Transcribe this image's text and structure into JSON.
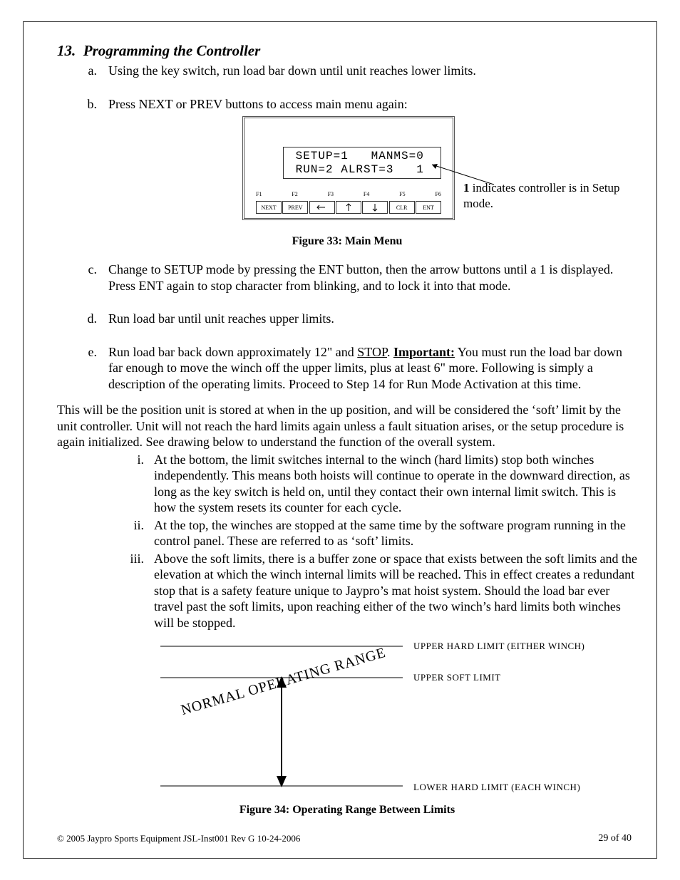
{
  "section": {
    "number": "13.",
    "title": "Programming the Controller"
  },
  "steps": {
    "a": {
      "marker": "a.",
      "text": "Using the key switch, run load bar down until unit reaches lower limits."
    },
    "b": {
      "marker": "b.",
      "text": "Press NEXT or PREV buttons to access main menu again:"
    },
    "c": {
      "marker": "c.",
      "text": "Change to SETUP mode by pressing the ENT button, then the arrow buttons until a 1 is displayed. Press ENT again to stop character from blinking, and to lock it into that mode."
    },
    "d": {
      "marker": "d.",
      "text": "Run load bar until unit reaches upper limits."
    },
    "e": {
      "marker": "e.",
      "lead": "Run load bar back down approximately 12\" and ",
      "stop": "STOP",
      "dot": ".  ",
      "imp": "Important:",
      "rest": " You must run the load bar down far enough to move the winch off the upper limits, plus at least 6\" more. Following is simply a description of the operating limits. Proceed to Step 14 for Run Mode Activation at this time."
    }
  },
  "fig1": {
    "lcd_line1": " SETUP=1   MANMS=0",
    "lcd_line2": " RUN=2 ALRST=3   1",
    "f_labels": [
      "F1",
      "F2",
      "F3",
      "F4",
      "F5",
      "F6"
    ],
    "buttons": [
      "NEXT",
      "PREV",
      "←",
      "↑",
      "↓",
      "CLR",
      "ENT"
    ],
    "callout_bold": "1",
    "callout_rest": " indicates controller is in Setup mode.",
    "caption": "Figure 33: Main Menu"
  },
  "paragraph": "This will be the position unit is stored at when in the up position, and will be considered the ‘soft’ limit by the unit controller. Unit will not reach the hard limits again unless a fault situation arises, or the setup procedure is again initialized. See drawing below to understand the function of the overall system.",
  "subs": {
    "i": {
      "rm": "i.",
      "text": "At the bottom, the limit switches internal to the winch (hard limits) stop both winches independently. This means both hoists will continue to operate in the downward direction, as long as the key switch is held on, until they contact their own internal limit switch. This is how the system resets its counter for each cycle."
    },
    "ii": {
      "rm": "ii.",
      "text": "At the top, the winches are stopped at the same time by the software program running in the control panel. These are referred to as ‘soft’ limits."
    },
    "iii": {
      "rm": "iii.",
      "text": "Above the soft limits, there is a buffer zone or space that exists between the soft limits and the elevation at which the winch internal limits will be reached. This in effect creates a redundant stop that is a safety feature unique to Jaypro’s mat hoist system. Should the load bar ever travel past the soft limits, upon reaching either of the two winch’s hard limits both winches will be stopped."
    }
  },
  "fig2": {
    "upper_hard": "UPPER HARD LIMIT (EITHER WINCH)",
    "upper_soft": "UPPER SOFT LIMIT",
    "lower_hard": "LOWER HARD LIMIT (EACH WINCH)",
    "normal": "NORMAL OPERATING RANGE",
    "caption": "Figure 34: Operating Range Between Limits"
  },
  "footer": {
    "copyright": "© 2005 Jaypro Sports Equipment  JSL-Inst001 Rev G  10-24-2006",
    "page": "29 of 40"
  }
}
